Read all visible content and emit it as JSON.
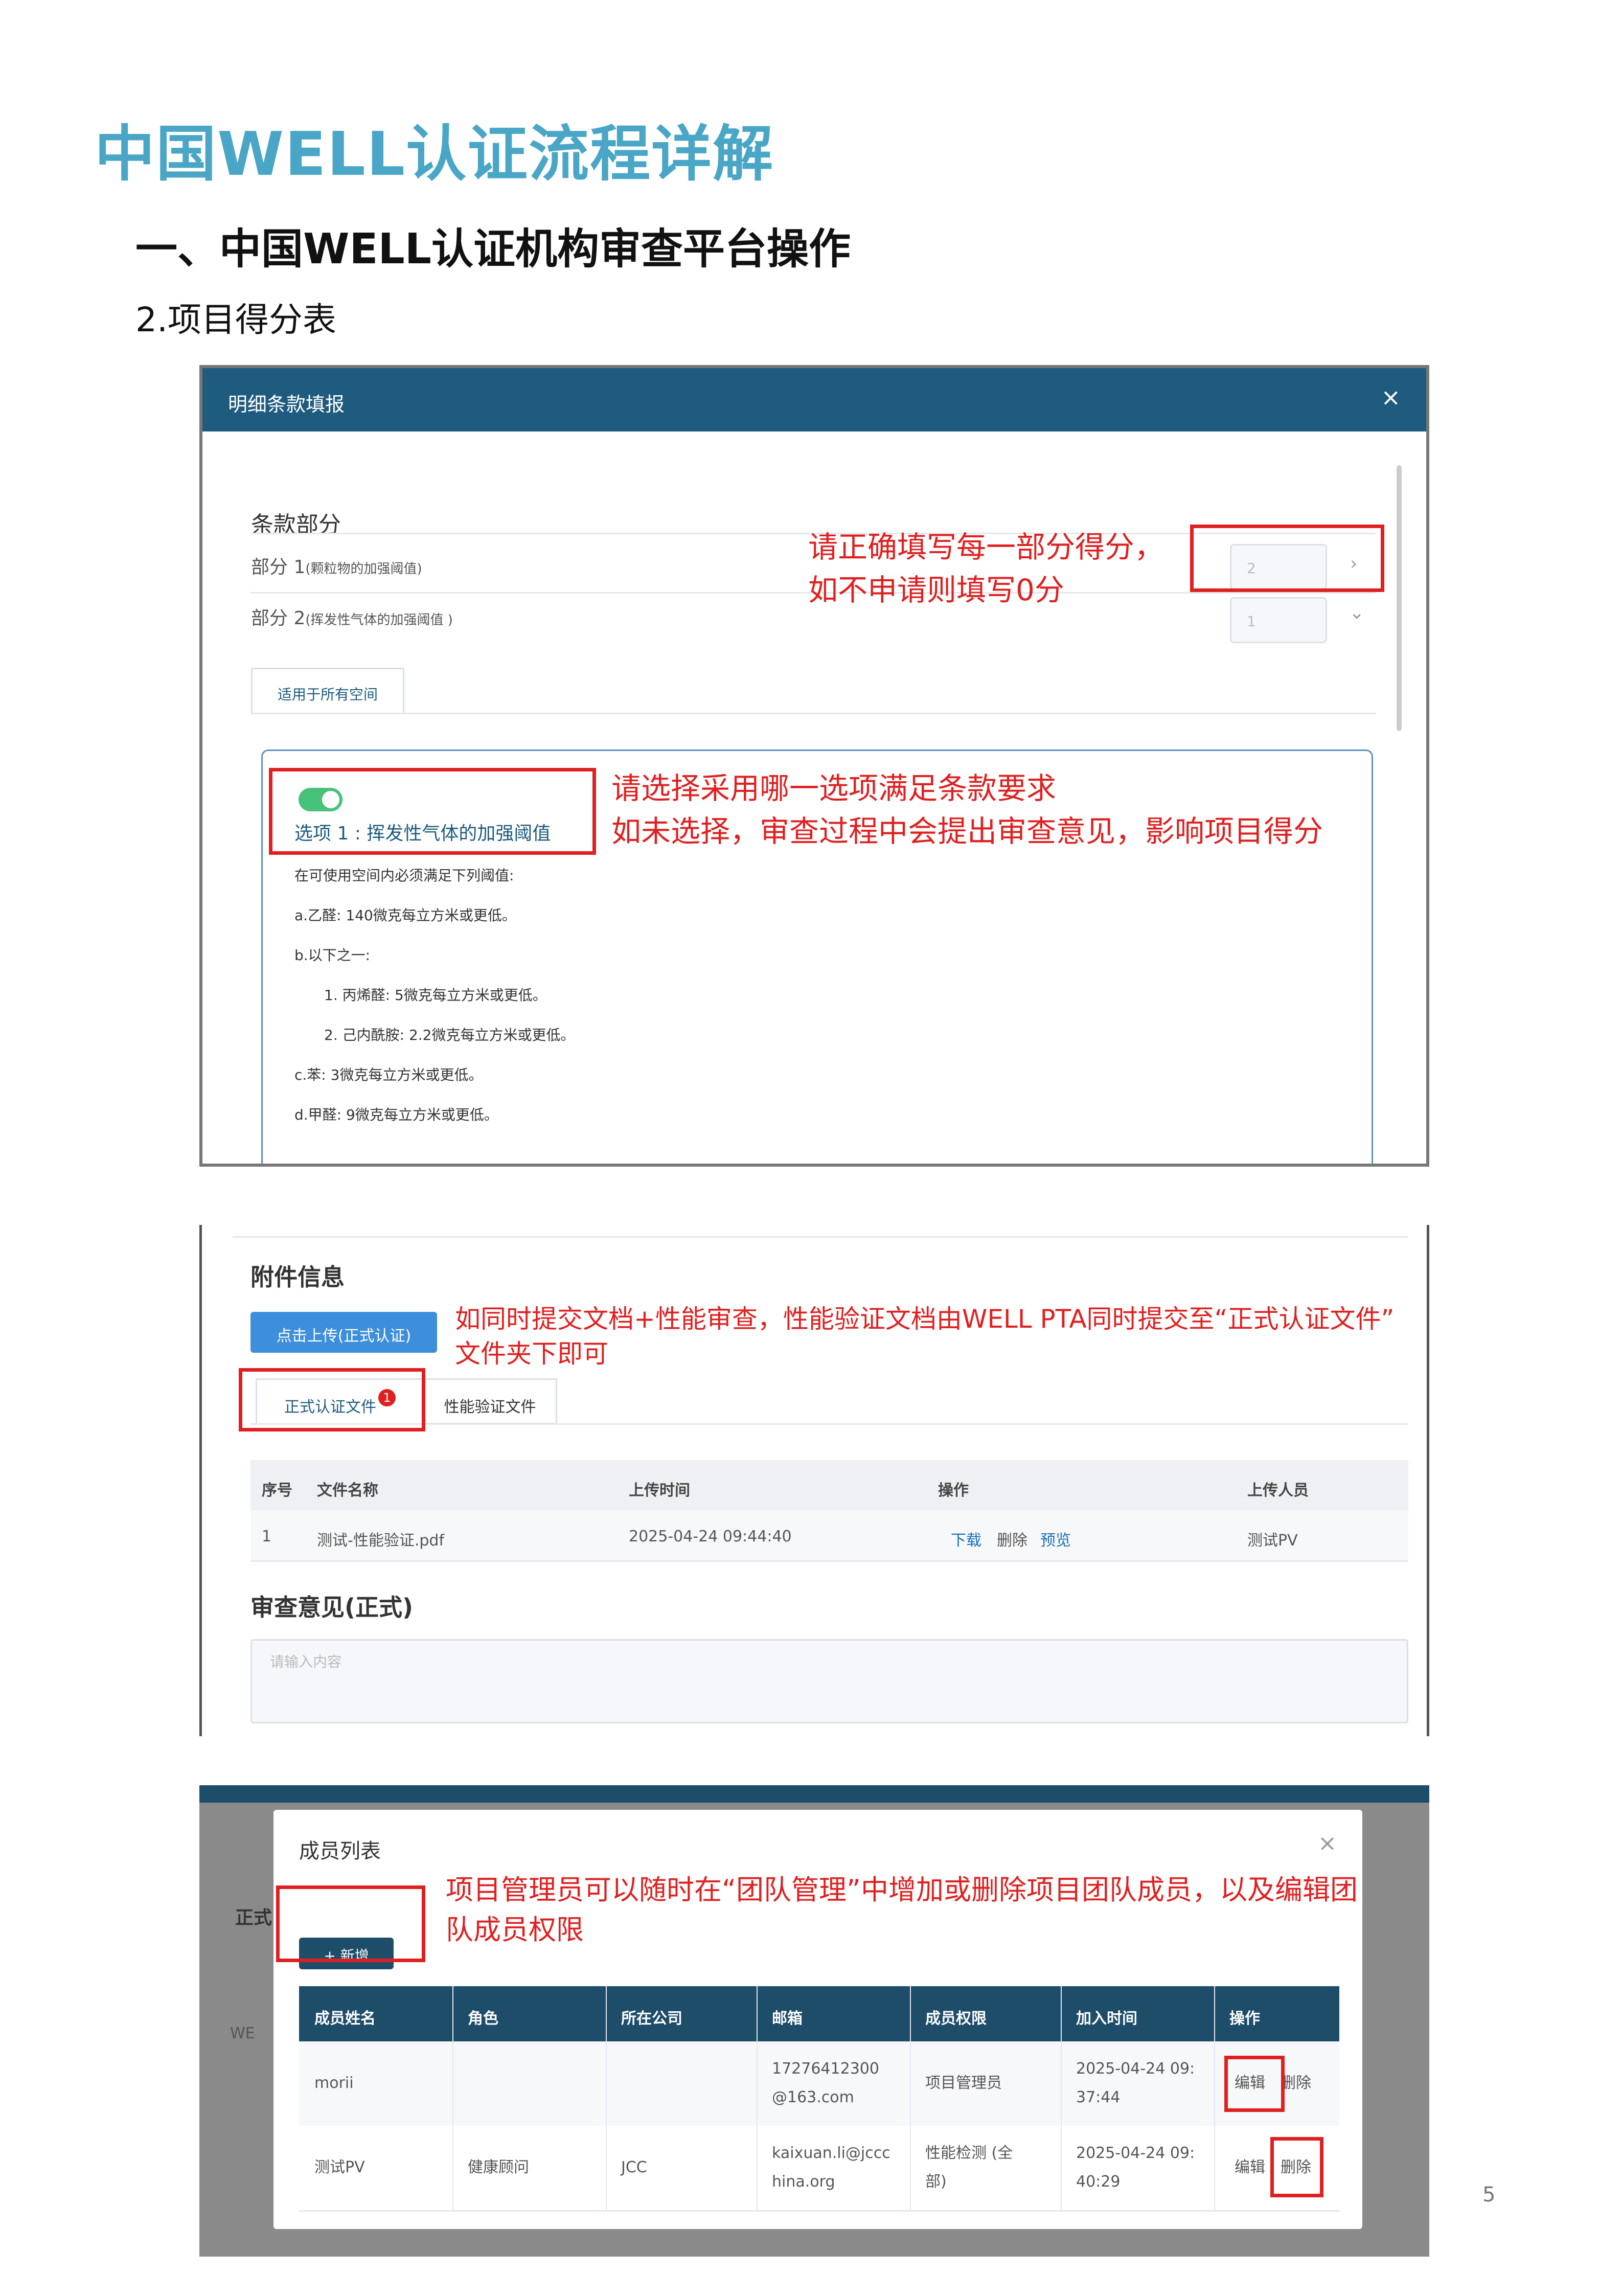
{
  "page": {
    "title": "中国WELL认证流程详解",
    "section": "一、中国WELL认证机构审查平台操作",
    "subsection": "2.项目得分表",
    "page_number": "5"
  },
  "shot1": {
    "dialog_title": "明细条款填报",
    "close": "×",
    "section_label": "条款部分",
    "part1_label": "部分 1",
    "part1_note": "(颗粒物的加强阈值)",
    "part1_value": "2",
    "part2_label": "部分 2",
    "part2_note": "(挥发性气体的加强阈值 )",
    "part2_value": "1",
    "tab_label": "适用于所有空间",
    "option_title": "选项 1 : 挥发性气体的加强阈值",
    "option_lines": [
      "在可使用空间内必须满足下列阈值:",
      "a.乙醛: 140微克每立方米或更低。",
      "b.以下之一:",
      "1. 丙烯醛: 5微克每立方米或更低。",
      "2. 己内酰胺: 2.2微克每立方米或更低。",
      "c.苯: 3微克每立方米或更低。",
      "d.甲醛: 9微克每立方米或更低。"
    ],
    "annotation_score": [
      "请正确填写每一部分得分，",
      "如不申请则填写0分"
    ],
    "annotation_option": [
      "请选择采用哪一选项满足条款要求",
      "如未选择，审查过程中会提出审查意见，影响项目得分"
    ]
  },
  "shot2": {
    "section_label": "附件信息",
    "upload_button": "点击上传(正式认证)",
    "tab_formal": "正式认证文件",
    "tab_badge": "1",
    "tab_perf": "性能验证文件",
    "annotation": [
      "如同时提交文档+性能审查，性能验证文档由WELL PTA同时提交至“正式认证文件”",
      "文件夹下即可"
    ],
    "table_headers": [
      "序号",
      "文件名称",
      "上传时间",
      "操作",
      "上传人员"
    ],
    "row": {
      "index": "1",
      "name": "测试-性能验证.pdf",
      "time": "2025-04-24 09:44:40",
      "download": "下载",
      "delete": "删除",
      "preview": "预览",
      "uploader": "测试PV"
    },
    "review_label": "审查意见(正式)",
    "review_placeholder": "请输入内容"
  },
  "shot3": {
    "modal_title": "成员列表",
    "close": "×",
    "add_button": "+ 新增",
    "annotation": [
      "项目管理员可以随时在“团队管理”中增加或删除项目团队成员，以及编辑团",
      "队成员权限"
    ],
    "headers": [
      "成员姓名",
      "角色",
      "所在公司",
      "邮箱",
      "成员权限",
      "加入时间",
      "操作"
    ],
    "rows": [
      {
        "name": "morii",
        "role": "",
        "company": "",
        "email": [
          "17276412300",
          "@163.com"
        ],
        "perm": "项目管理员",
        "time": [
          "2025-04-24 09:",
          "37:44"
        ],
        "edit": "编辑",
        "del": "删除"
      },
      {
        "name": "测试PV",
        "role": "健康顾问",
        "company": "JCC",
        "email": [
          "kaixuan.li@jccc",
          "hina.org"
        ],
        "perm": [
          "性能检测 (全",
          "部)"
        ],
        "time": [
          "2025-04-24 09:",
          "40:29"
        ],
        "edit": "编辑",
        "del": "删除"
      }
    ],
    "background_fragments": [
      "正式",
      "WE"
    ]
  }
}
